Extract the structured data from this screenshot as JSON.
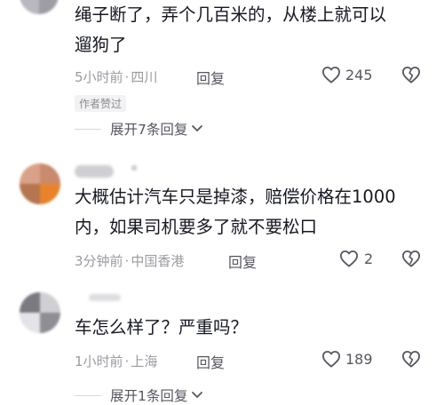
{
  "comments": [
    {
      "text_lines": [
        "绳子断了，弄个几百米的，从楼上就可以",
        "遛狗了"
      ],
      "time": "5小时前",
      "location": "四川",
      "reply_label": "回复",
      "likes": "245",
      "badge": "作者赞过",
      "expand_label": "展开7条回复"
    },
    {
      "text_lines": [
        "大概估计汽车只是掉漆，赔偿价格在1000",
        "内，如果司机要多了就不要松口"
      ],
      "time": "3分钟前",
      "location": "中国香港",
      "reply_label": "回复",
      "likes": "2"
    },
    {
      "text_lines": [
        "车怎么样了？严重吗？"
      ],
      "time": "1小时前",
      "location": "上海",
      "reply_label": "回复",
      "likes": "189",
      "expand_label": "展开1条回复"
    }
  ],
  "meta_separator": "·",
  "colors": {
    "text": "#161823",
    "meta": "#9a9ba1",
    "action": "#555660",
    "badge_bg": "#f2f2f4"
  },
  "icons": {
    "like": "heart-outline-icon",
    "dislike": "broken-heart-icon",
    "expand": "chevron-down-icon"
  }
}
